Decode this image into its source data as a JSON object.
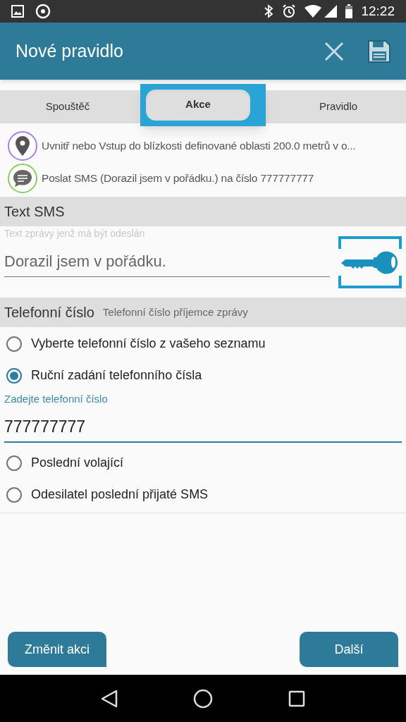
{
  "status_bar": {
    "time": "12:22"
  },
  "app_bar": {
    "title": "Nové pravidlo"
  },
  "tabs": [
    {
      "label": "Spouštěč",
      "selected": false
    },
    {
      "label": "Akce",
      "selected": true
    },
    {
      "label": "Pravidlo",
      "selected": false
    }
  ],
  "summary": [
    {
      "kind": "location",
      "text": "Uvnitř nebo Vstup do blízkosti definované oblasti 200.0 metrů v o...",
      "color": "#a57ff0"
    },
    {
      "kind": "sms",
      "text": "Poslat SMS (Dorazil jsem v pořádku.) na číslo 777777777",
      "color": "#8cd05a"
    }
  ],
  "sms_section": {
    "title": "Text SMS",
    "hint": "Text zprávy jenž má být odeslán",
    "value": "Dorazil jsem v pořádku."
  },
  "phone_section": {
    "title": "Telefonní číslo",
    "subtitle": "Telefonní číslo příjemce zprávy"
  },
  "options": [
    {
      "label": "Vyberte telefonní číslo z vašeho seznamu",
      "selected": false
    },
    {
      "label": "Ruční zadání telefonního čísla",
      "selected": true,
      "input": {
        "label": "Zadejte telefonní číslo",
        "value": "777777777"
      }
    },
    {
      "label": "Poslední volající",
      "selected": false
    },
    {
      "label": "Odesilatel poslední přijaté SMS",
      "selected": false
    }
  ],
  "buttons": {
    "back": "Změnit akci",
    "next": "Další"
  }
}
